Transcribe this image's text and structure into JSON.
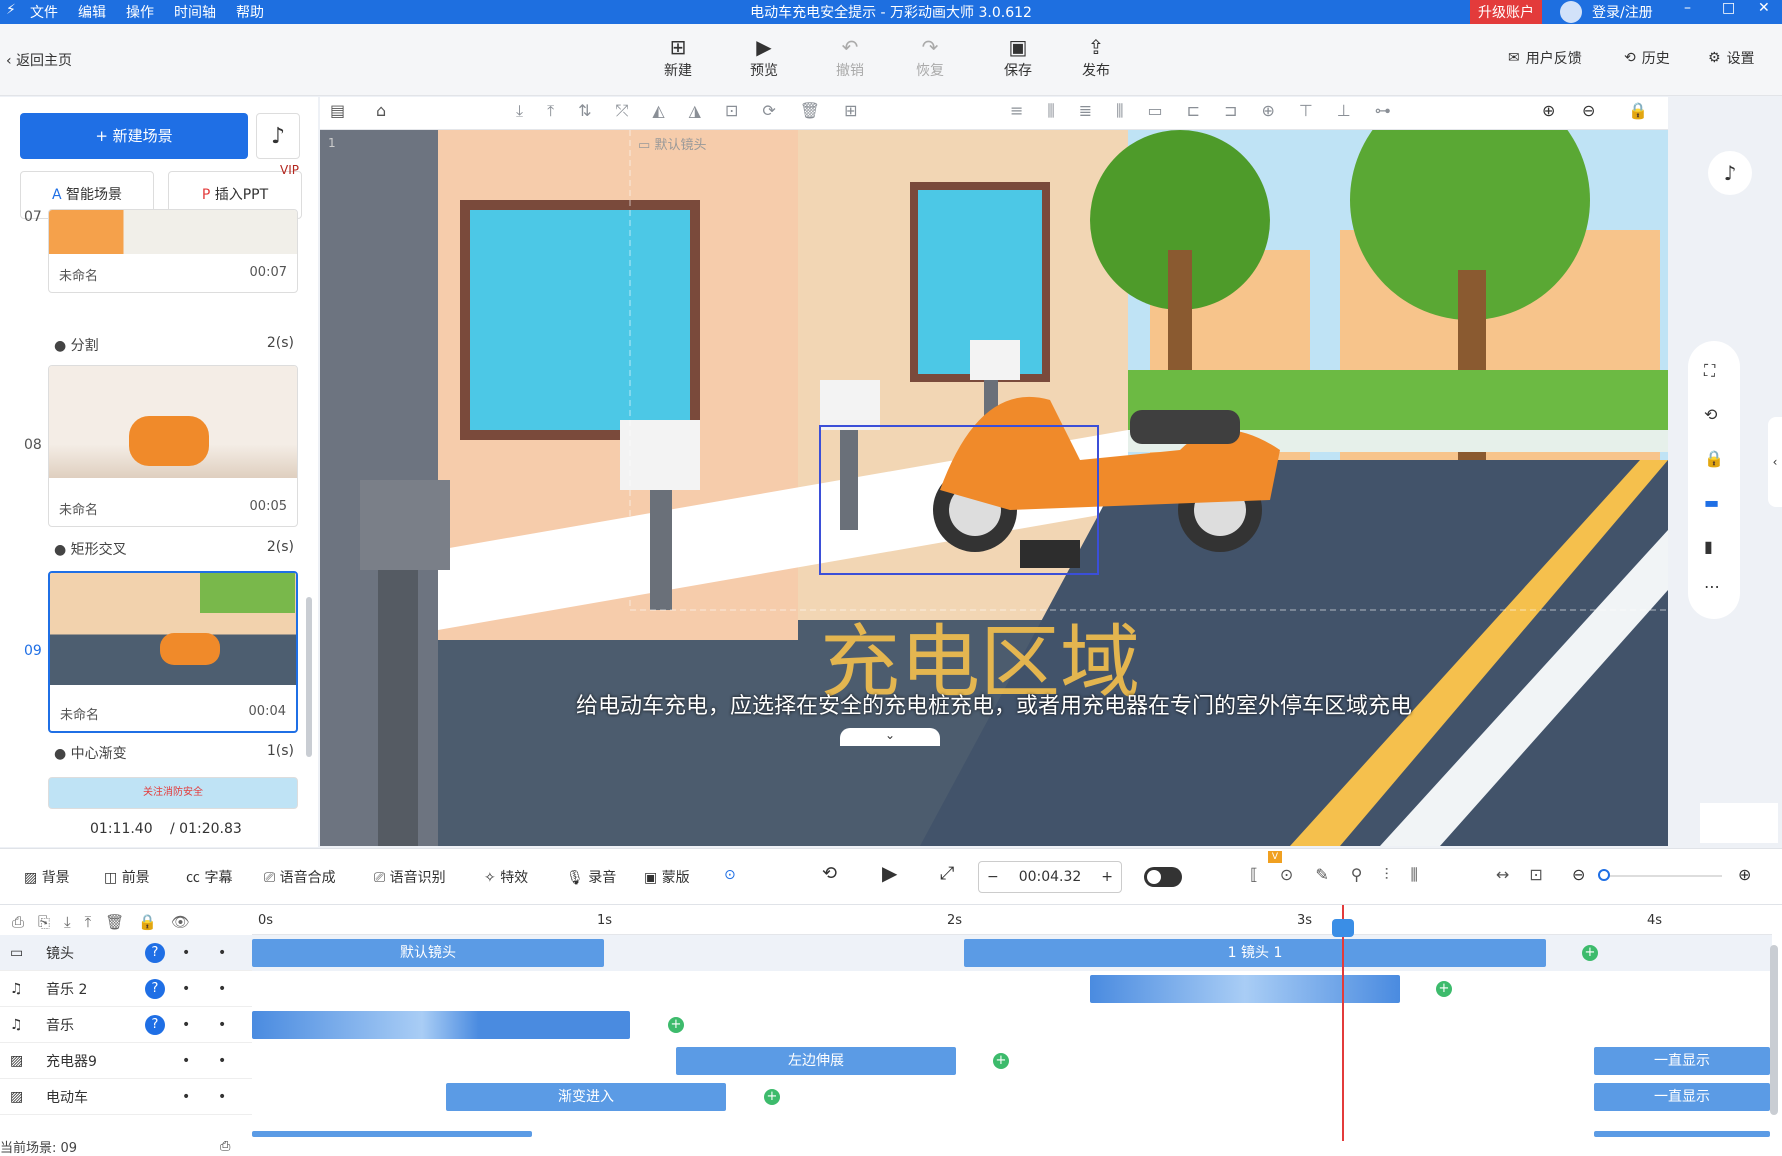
{
  "app": {
    "title": "电动车充电安全提示 - 万彩动画大师 3.0.612",
    "menu": [
      "文件",
      "编辑",
      "操作",
      "时间轴",
      "帮助"
    ],
    "upgrade": "升级账户",
    "login": "登录/注册"
  },
  "toolbar": {
    "back": "返回主页",
    "new": "新建",
    "preview": "预览",
    "undo": "撤销",
    "redo": "恢复",
    "save": "保存",
    "publish": "发布",
    "feedback": "用户反馈",
    "history": "历史",
    "settings": "设置"
  },
  "left": {
    "new_scene": "+ 新建场景",
    "smart_scene": "智能场景",
    "insert_ppt": "插入PPT",
    "vip": "VIP",
    "scenes": [
      {
        "index": "07",
        "name": "未命名",
        "time": "00:07",
        "transition": "分割",
        "trans_time": "2(s)"
      },
      {
        "index": "08",
        "name": "未命名",
        "time": "00:05",
        "transition": "矩形交叉",
        "trans_time": "2(s)"
      },
      {
        "index": "09",
        "name": "未命名",
        "time": "00:04",
        "transition": "中心渐变",
        "trans_time": "1(s)"
      }
    ],
    "next_thumb_text": "关注消防安全",
    "elapsed": "01:11.40",
    "total": "/ 01:20.83",
    "current_scene": "当前场景: 09"
  },
  "canvas": {
    "camera_label": "默认镜头",
    "subtitle": "给电动车充电，应选择在安全的充电桩充电，或者用充电器在专门的室外停车区域充电",
    "ruler_mark": "1"
  },
  "bottombar": {
    "bg": "背景",
    "fg": "前景",
    "caption": "字幕",
    "tts": "语音合成",
    "asr": "语音识别",
    "fx": "特效",
    "record": "录音",
    "mask": "蒙版",
    "time": "00:04.32"
  },
  "timeline": {
    "ticks": [
      "0s",
      "1s",
      "2s",
      "3s",
      "4s"
    ],
    "tracks": [
      {
        "name": "镜头",
        "icon": "camera-icon"
      },
      {
        "name": "音乐 2",
        "icon": "music-icon"
      },
      {
        "name": "音乐",
        "icon": "music-icon"
      },
      {
        "name": "充电器9",
        "icon": "image-icon"
      },
      {
        "name": "电动车",
        "icon": "image-icon"
      }
    ],
    "clips": {
      "cam1": "默认镜头",
      "cam2": "1 镜头 1",
      "charger": "左边伸展",
      "charger_end": "一直显示",
      "bike": "渐变进入",
      "bike_end": "一直显示"
    },
    "playhead_seconds": 3.1
  },
  "colors": {
    "accent": "#1e6fe0",
    "upgrade": "#e33b3b",
    "keyframe": "#3dbb6c"
  }
}
